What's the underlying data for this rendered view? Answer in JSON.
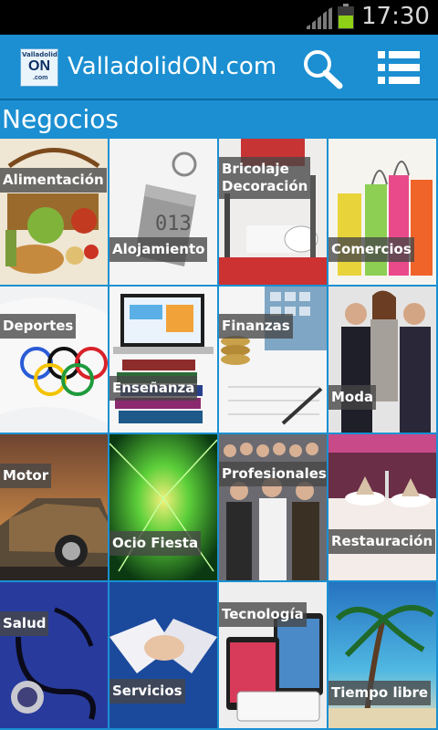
{
  "status": {
    "time": "17:30",
    "battery_color": "#8ed016"
  },
  "app": {
    "title": "ValladolidON.com",
    "logo_lines": [
      "Valladolid",
      "ON",
      ".com"
    ],
    "search_icon": "search-icon",
    "menu_icon": "list-menu-icon"
  },
  "section": {
    "title": "Negocios"
  },
  "categories": [
    {
      "label": "Alimentación"
    },
    {
      "label": "Alojamiento"
    },
    {
      "label": "Bricolaje Decoración",
      "line1": "Bricolaje",
      "line2": "Decoración"
    },
    {
      "label": "Comercios"
    },
    {
      "label": "Deportes"
    },
    {
      "label": "Enseñanza"
    },
    {
      "label": "Finanzas"
    },
    {
      "label": "Moda"
    },
    {
      "label": "Motor"
    },
    {
      "label": "Ocio Fiesta"
    },
    {
      "label": "Profesionales"
    },
    {
      "label": "Restauración"
    },
    {
      "label": "Salud"
    },
    {
      "label": "Servicios"
    },
    {
      "label": "Tecnología"
    },
    {
      "label": "Tiempo libre"
    }
  ],
  "colors": {
    "accent": "#1b8fd1",
    "status_bar": "#000000"
  }
}
